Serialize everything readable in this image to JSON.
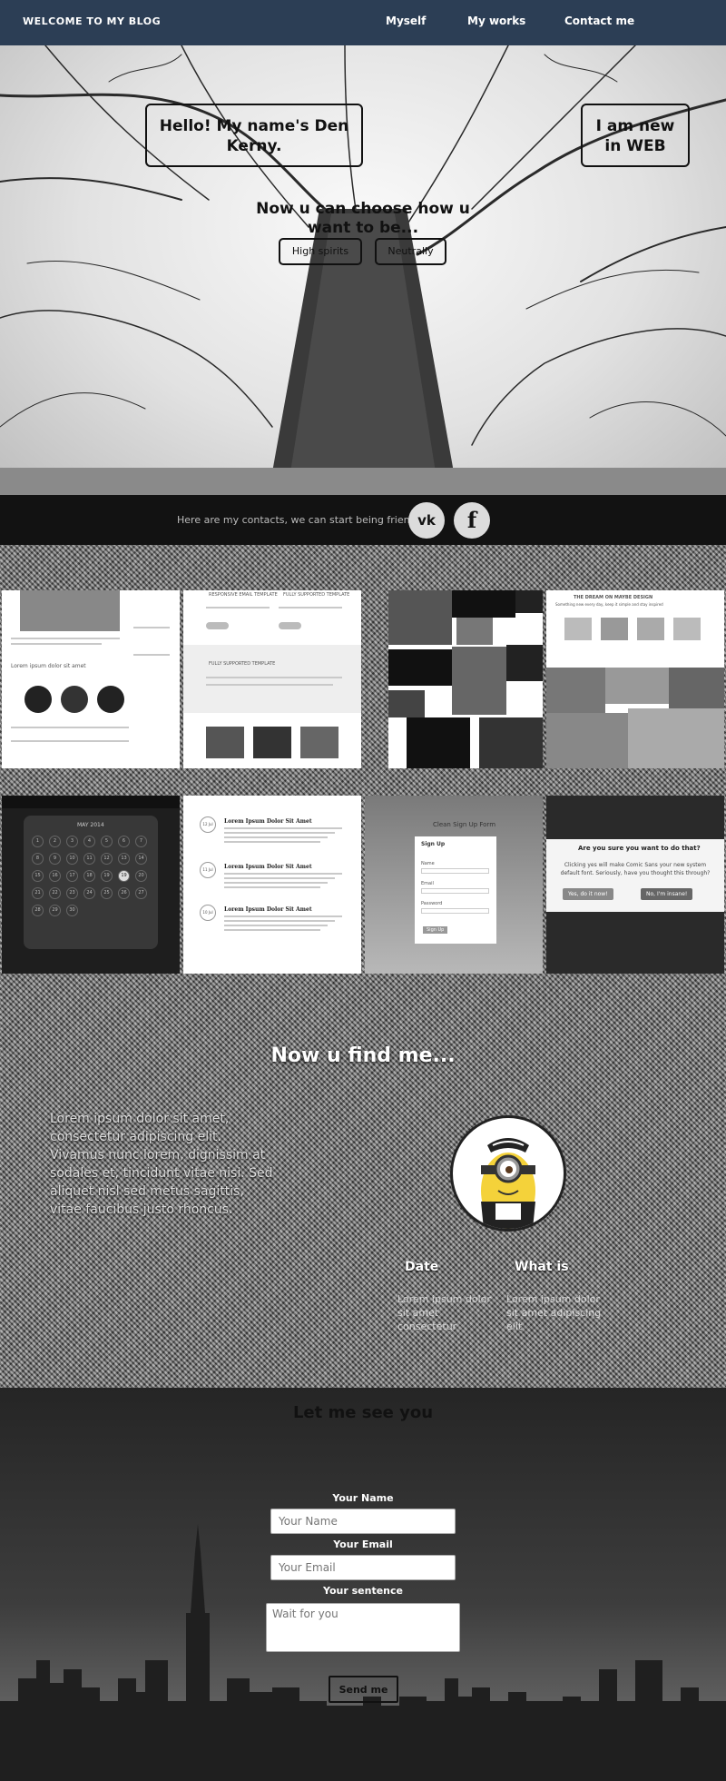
{
  "nav": {
    "brand": "WELCOME TO MY BLOG",
    "links": [
      "Myself",
      "My works",
      "Contact me"
    ]
  },
  "hero": {
    "greeting": "Hello! My name's Den Kerny.",
    "new_in_web": "I am new in WEB",
    "choose": "Now u can choose how u want to be...",
    "buttons": [
      "High spirits",
      "Neutrally"
    ]
  },
  "contacts": {
    "text": "Here are my contacts, we can start being friends",
    "social": [
      {
        "name": "vk",
        "glyph": "vk"
      },
      {
        "name": "facebook",
        "glyph": "f"
      }
    ]
  },
  "works": {
    "t1": {
      "caption": "Lorem ipsum dolor sit amet"
    },
    "t2": {
      "left_title": "RESPONSIVE EMAIL TEMPLATE",
      "right_title": "FULLY SUPPORTED TEMPLATE",
      "mid_title": "FULLY SUPPORTED TEMPLATE"
    },
    "t4": {
      "title": "THE DREAM ON MAYBE DESIGN",
      "subtitle": "Something new every day, keep it simple and stay inspired"
    },
    "t5": {
      "month": "MAY 2014",
      "days": [
        "1",
        "2",
        "3",
        "4",
        "5",
        "6",
        "7",
        "8",
        "9",
        "10",
        "11",
        "12",
        "13",
        "14",
        "15",
        "16",
        "17",
        "18",
        "19",
        "19",
        "20",
        "21",
        "22",
        "23",
        "24",
        "25",
        "26",
        "27",
        "28",
        "29",
        "30"
      ]
    },
    "t6": {
      "posts": [
        {
          "date": "12 Jul",
          "title": "Lorem Ipsum Dolor Sit Amet"
        },
        {
          "date": "11 Jul",
          "title": "Lorem Ipsum Dolor Sit Amet"
        },
        {
          "date": "10 Jul",
          "title": "Lorem Ipsum Dolor Sit Amet"
        }
      ]
    },
    "t7": {
      "heading": "Clean Sign Up Form",
      "box_title": "Sign Up",
      "fields": [
        "Name",
        "Email",
        "Password"
      ],
      "button": "Sign Up"
    },
    "t8": {
      "title": "Are you sure you want to do that?",
      "body": "Clicking yes will make Comic Sans your new system default font. Seriously, have you thought this through?",
      "yes": "Yes, do it now!",
      "no": "No, I'm insane!"
    }
  },
  "find": {
    "title": "Now u find me...",
    "text": "Lorem ipsum dolor sit amet, consectetur adipiscing elit. Vivamus nunc lorem, dignissim at sodales et, tincidunt vitae nisi. Sed aliquet nisl sed metus sagittis, vitae faucibus justo rhoncus.",
    "col1_title": "Date",
    "col1_text": "Lorem ipsum dolor sit amet consectetur",
    "col2_title": "What is",
    "col2_text": "Lorem ipsum dolor sit amet adipiscing elit"
  },
  "form": {
    "title": "Let me see you",
    "name_label": "Your Name",
    "name_placeholder": "Your Name",
    "email_label": "Your Email",
    "email_placeholder": "Your Email",
    "sentence_label": "Your sentence",
    "sentence_placeholder": "Wait for you",
    "submit": "Send me"
  }
}
